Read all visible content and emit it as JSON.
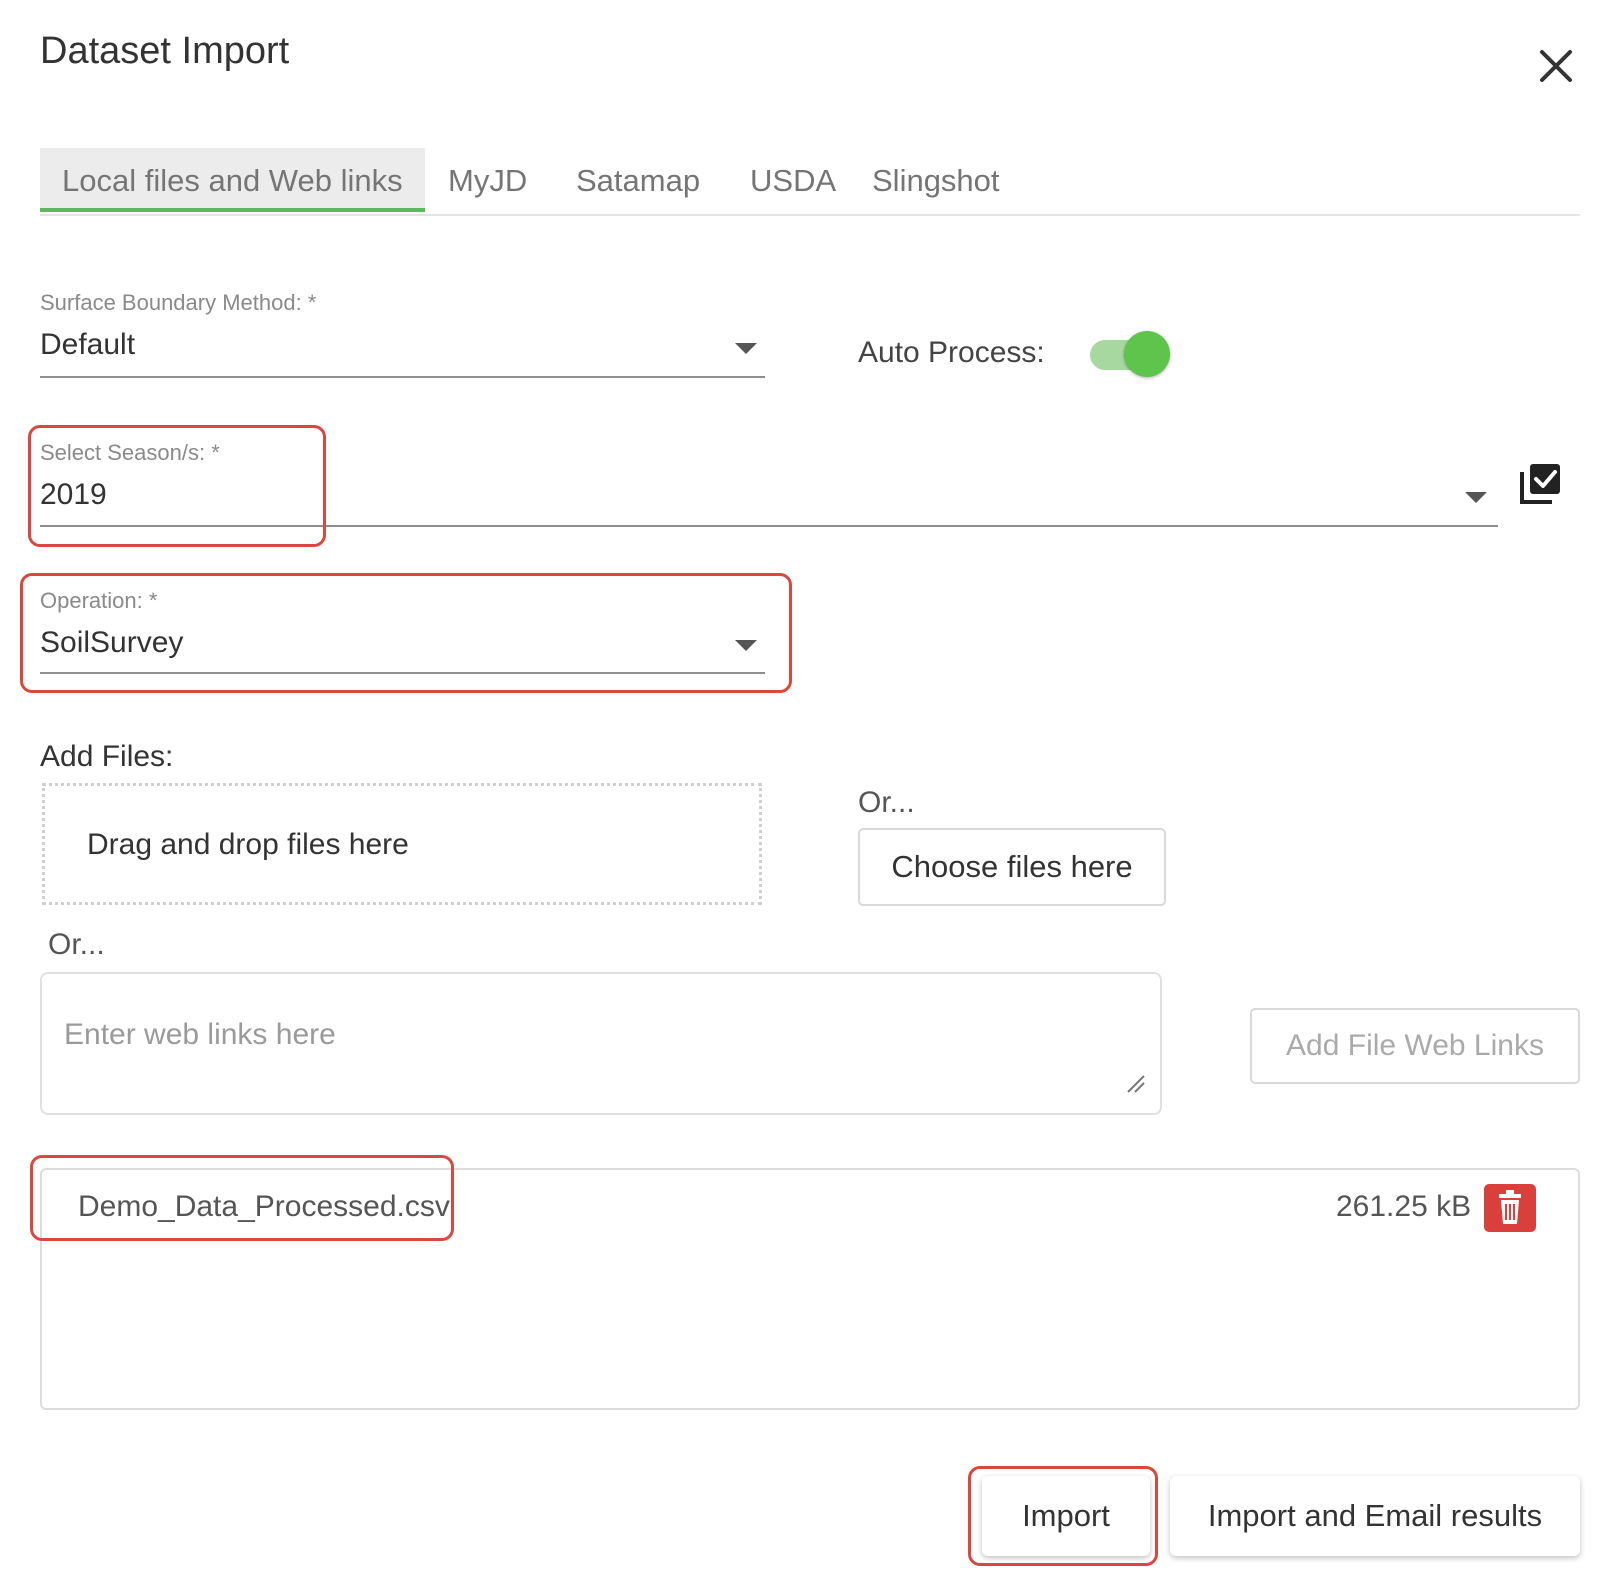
{
  "dialog": {
    "title": "Dataset Import"
  },
  "tabs": [
    {
      "label": "Local files and Web links",
      "active": true
    },
    {
      "label": "MyJD",
      "active": false
    },
    {
      "label": "Satamap",
      "active": false
    },
    {
      "label": "USDA",
      "active": false
    },
    {
      "label": "Slingshot",
      "active": false
    }
  ],
  "surface_boundary": {
    "label": "Surface Boundary Method: *",
    "value": "Default"
  },
  "auto_process": {
    "label": "Auto Process:",
    "enabled": true
  },
  "season": {
    "label": "Select Season/s: *",
    "value": "2019"
  },
  "operation": {
    "label": "Operation: *",
    "value": "SoilSurvey"
  },
  "add_files": {
    "label": "Add Files:",
    "dropzone_text": "Drag and drop files here",
    "or_text": "Or...",
    "choose_button": "Choose files here",
    "or_text_2": "Or...",
    "web_links_placeholder": "Enter web links here",
    "add_links_button": "Add File Web Links"
  },
  "files": [
    {
      "name": "Demo_Data_Processed.csv",
      "size": "261.25 kB"
    }
  ],
  "actions": {
    "import": "Import",
    "import_email": "Import and Email results"
  },
  "colors": {
    "accent_green": "#5cb85c",
    "highlight_red": "#d9473f",
    "delete_red": "#d9403c"
  }
}
